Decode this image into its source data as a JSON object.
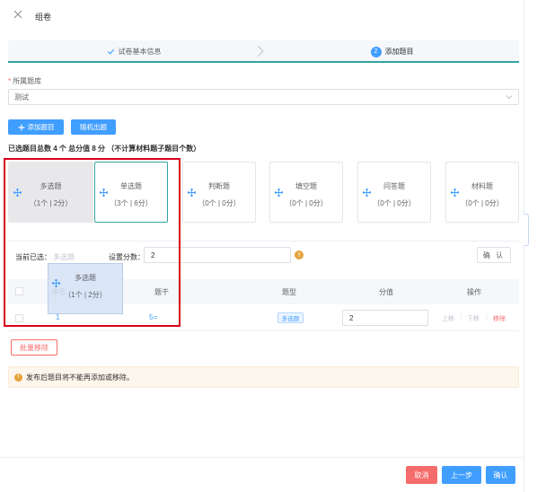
{
  "header": {
    "title": "组卷"
  },
  "steps": [
    {
      "label": "试卷基本信息",
      "state": "done"
    },
    {
      "label": "添加题目",
      "number": "2",
      "state": "active"
    }
  ],
  "form": {
    "bank_label": "所属题库",
    "bank_required_mark": "*",
    "bank_value": "测试"
  },
  "toolbar": {
    "add_label": "添加题目",
    "random_label": "随机出题"
  },
  "summary": "已选题目总数 4 个 总分值 8 分 （不计算材料题子题目个数）",
  "question_types": [
    {
      "name": "多选题",
      "count": "（1个 | 2分）",
      "state": "dragging-source"
    },
    {
      "name": "单选题",
      "count": "（3个 | 6分）",
      "state": "active"
    },
    {
      "name": "判断题",
      "count": "（0个 | 0分）",
      "state": "normal"
    },
    {
      "name": "填空题",
      "count": "（0个 | 0分）",
      "state": "normal"
    },
    {
      "name": "问答题",
      "count": "（0个 | 0分）",
      "state": "normal"
    },
    {
      "name": "材料题",
      "count": "（0个 | 0分）",
      "state": "normal"
    }
  ],
  "selection": {
    "current_label": "当前已选：",
    "current_value": "多选题",
    "score_label": "设置分数：",
    "score_value": "2",
    "warn_glyph": "!",
    "confirm_label": "确 认"
  },
  "table": {
    "columns": [
      "序号",
      "题干",
      "题型",
      "分值",
      "操作"
    ],
    "rows": [
      {
        "index": "1",
        "stem": "5=",
        "type": "多选题",
        "score": "2",
        "ops": [
          "上移",
          "下移",
          "移除"
        ]
      }
    ]
  },
  "batch_remove_label": "批量移除",
  "notice": {
    "icon_glyph": "!",
    "text": "发布后题目将不能再添加或移除。"
  },
  "footer": {
    "cancel_label": "取消",
    "prev_label": "上一步",
    "ok_label": "确认"
  },
  "drag_ghost": {
    "name": "多选题",
    "count": "（1个 | 2分）"
  },
  "colors": {
    "primary": "#409eff",
    "danger": "#f56c6c",
    "warning": "#e6a23c",
    "teal": "#33a3a3",
    "highlight_box": "#d9001b"
  }
}
